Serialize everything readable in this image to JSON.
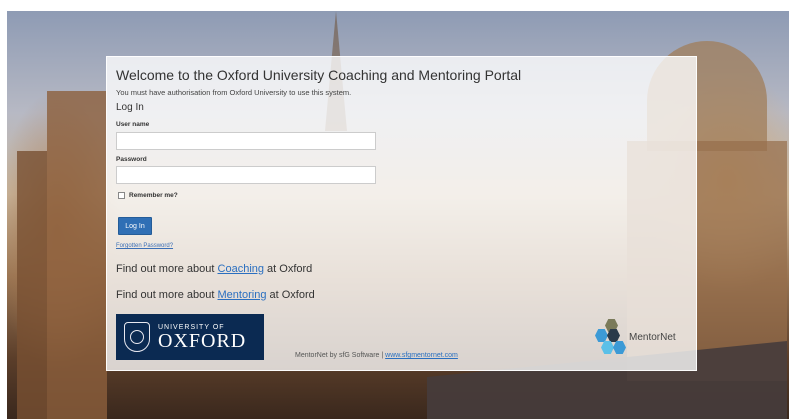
{
  "portal": {
    "title": "Welcome to the Oxford University Coaching and Mentoring Portal",
    "notice": "You must have authorisation from Oxford University to use this system.",
    "login_heading": "Log In"
  },
  "form": {
    "username_label": "User name",
    "username_value": "",
    "password_label": "Password",
    "password_value": "",
    "remember_label": "Remember me?",
    "remember_checked": false,
    "login_button": "Log In",
    "forgot_link": "Forgotten Password?"
  },
  "findout": {
    "coaching_prefix": "Find out more about ",
    "coaching_link": "Coaching",
    "coaching_suffix": " at Oxford",
    "mentoring_prefix": "Find out more about ",
    "mentoring_link": "Mentoring",
    "mentoring_suffix": " at Oxford"
  },
  "oxford_logo": {
    "line1": "UNIVERSITY OF",
    "line2": "OXFORD",
    "color": "#0b2a52"
  },
  "footer": {
    "text": "MentorNet by sfG Software | ",
    "link": "www.sfgmentornet.com"
  },
  "mentornet_logo": {
    "label": "MentorNet",
    "hex_colors": [
      "#3c9ad6",
      "#2a3a4a",
      "#7a7a5a",
      "#5bc0e8"
    ]
  },
  "colors": {
    "accent": "#2f6fb5",
    "link": "#2a6fc0"
  }
}
